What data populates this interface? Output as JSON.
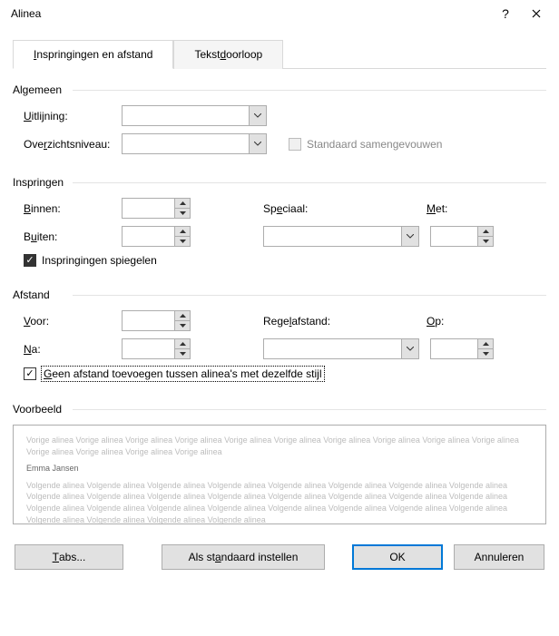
{
  "title": "Alinea",
  "tabs": {
    "indent": "Inspringingen en afstand",
    "textflow": "Tekstdoorloop"
  },
  "general": {
    "section": "Algemeen",
    "alignment_label_pre": "U",
    "alignment_label_post": "itlijning:",
    "outline_pre": "Ove",
    "outline_mid": "r",
    "outline_post": "zichtsniveau:",
    "collapsed": "Standaard samengevouwen"
  },
  "indent": {
    "section": "Inspringen",
    "inside_pre": "B",
    "inside_post": "innen:",
    "outside_pre": "B",
    "outside_mid": "u",
    "outside_post": "iten:",
    "special_pre": "Sp",
    "special_mid": "e",
    "special_post": "ciaal:",
    "by_pre": "M",
    "by_mid": "e",
    "by_post": "t:",
    "mirror": "Inspringingen spiegelen"
  },
  "spacing": {
    "section": "Afstand",
    "before_pre": "V",
    "before_post": "oor:",
    "after_pre": "N",
    "after_mid": "a",
    "after_post": ":",
    "linespacing_pre": "Rege",
    "linespacing_mid": "l",
    "linespacing_post": "afstand:",
    "at_pre": "O",
    "at_mid": "p",
    "at_post": ":",
    "nospace_pre": "G",
    "nospace_post": "een afstand toevoegen tussen alinea's met dezelfde stijl"
  },
  "preview": {
    "section": "Voorbeeld",
    "prev": "Vorige alinea Vorige alinea Vorige alinea Vorige alinea Vorige alinea Vorige alinea Vorige alinea Vorige alinea Vorige alinea Vorige alinea Vorige alinea Vorige alinea Vorige alinea Vorige alinea",
    "sample": "Emma Jansen",
    "next": "Volgende alinea Volgende alinea Volgende alinea Volgende alinea Volgende alinea Volgende alinea Volgende alinea Volgende alinea Volgende alinea Volgende alinea Volgende alinea Volgende alinea Volgende alinea Volgende alinea Volgende alinea Volgende alinea Volgende alinea Volgende alinea Volgende alinea Volgende alinea Volgende alinea Volgende alinea Volgende alinea Volgende alinea Volgende alinea Volgende alinea Volgende alinea Volgende alinea"
  },
  "buttons": {
    "tabs_pre": "T",
    "tabs_post": "abs...",
    "default_pre": "Als st",
    "default_mid": "a",
    "default_post": "ndaard instellen",
    "ok": "OK",
    "cancel": "Annuleren"
  }
}
